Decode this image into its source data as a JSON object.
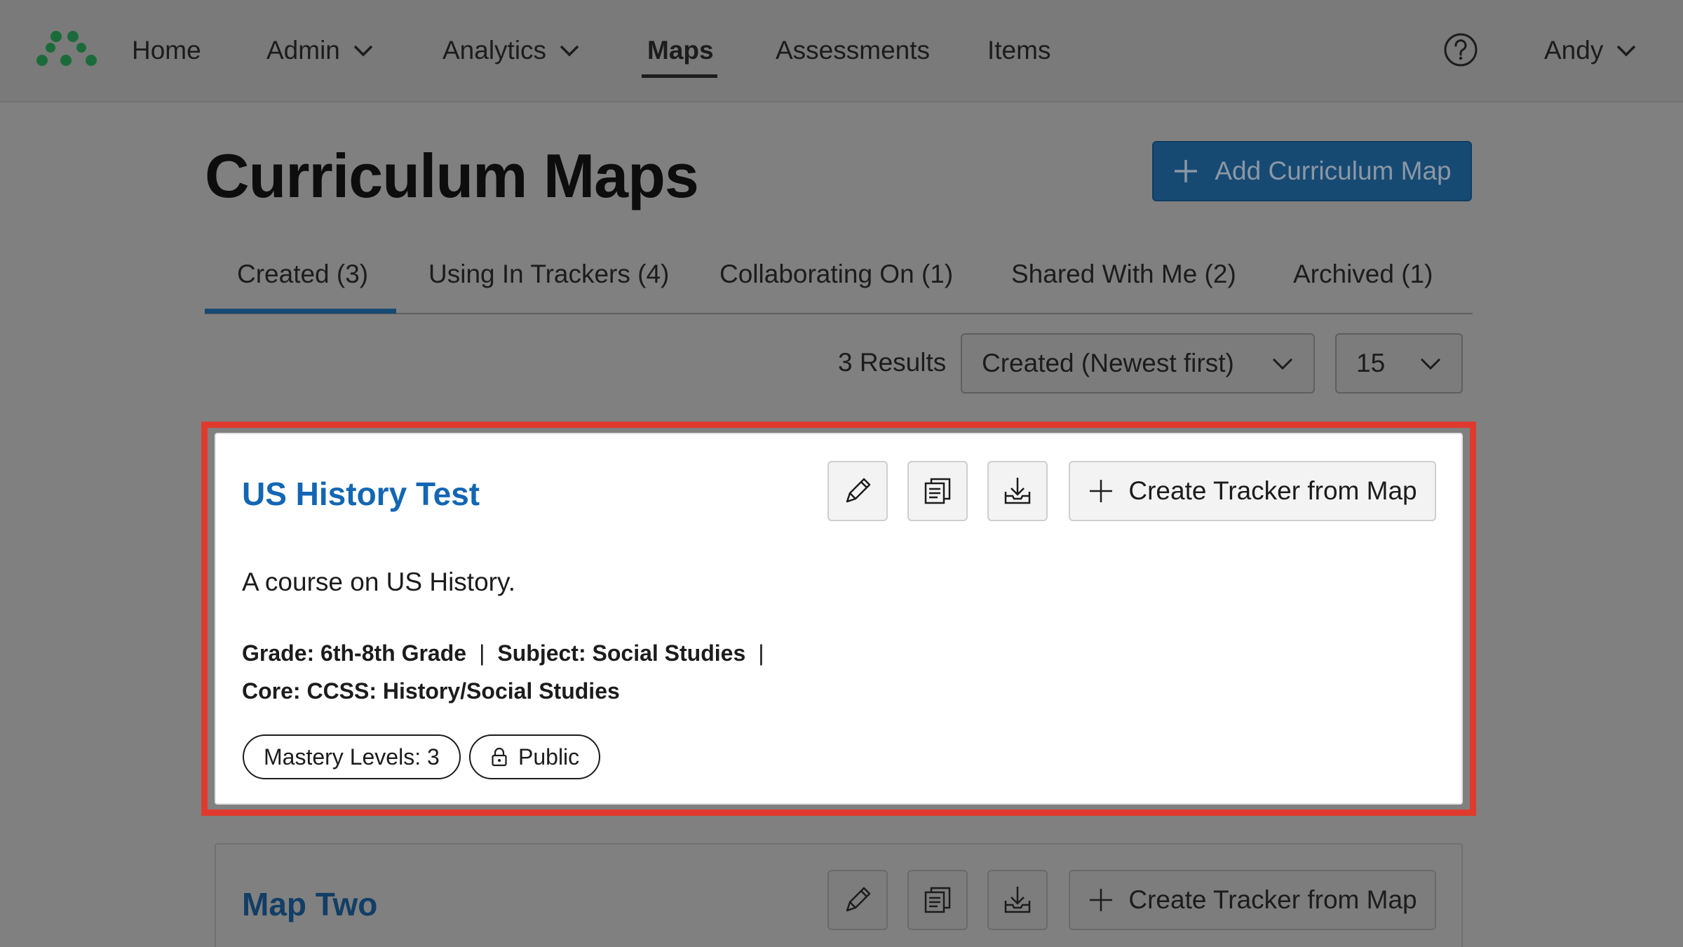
{
  "nav": {
    "items": [
      {
        "label": "Home"
      },
      {
        "label": "Admin"
      },
      {
        "label": "Analytics"
      },
      {
        "label": "Maps"
      },
      {
        "label": "Assessments"
      },
      {
        "label": "Items"
      }
    ],
    "user": "Andy",
    "logo_icon": "network-dots-logo",
    "help_icon": "question-circle-icon"
  },
  "page": {
    "title": "Curriculum Maps",
    "add_button": "Add Curriculum Map"
  },
  "tabs": [
    {
      "label": "Created (3)",
      "active": true
    },
    {
      "label": "Using In Trackers (4)"
    },
    {
      "label": "Collaborating On (1)"
    },
    {
      "label": "Shared With Me (2)"
    },
    {
      "label": "Archived (1)"
    }
  ],
  "results": {
    "count_label": "3 Results",
    "sort_value": "Created (Newest first)",
    "per_page": "15"
  },
  "cards": [
    {
      "title": "US History Test",
      "description": "A course on US History.",
      "grade": "Grade: 6th-8th Grade",
      "subject": "Subject: Social Studies",
      "core": "Core: CCSS: History/Social Studies",
      "mastery": "Mastery Levels: 3",
      "visibility": "Public",
      "tracker_button": "Create Tracker from Map"
    },
    {
      "title": "Map Two",
      "tracker_button": "Create Tracker from Map"
    }
  ],
  "colors": {
    "accent": "#174a73",
    "link": "#1366b3",
    "highlight": "#e03a2f",
    "logo": "#1b6b3a"
  }
}
